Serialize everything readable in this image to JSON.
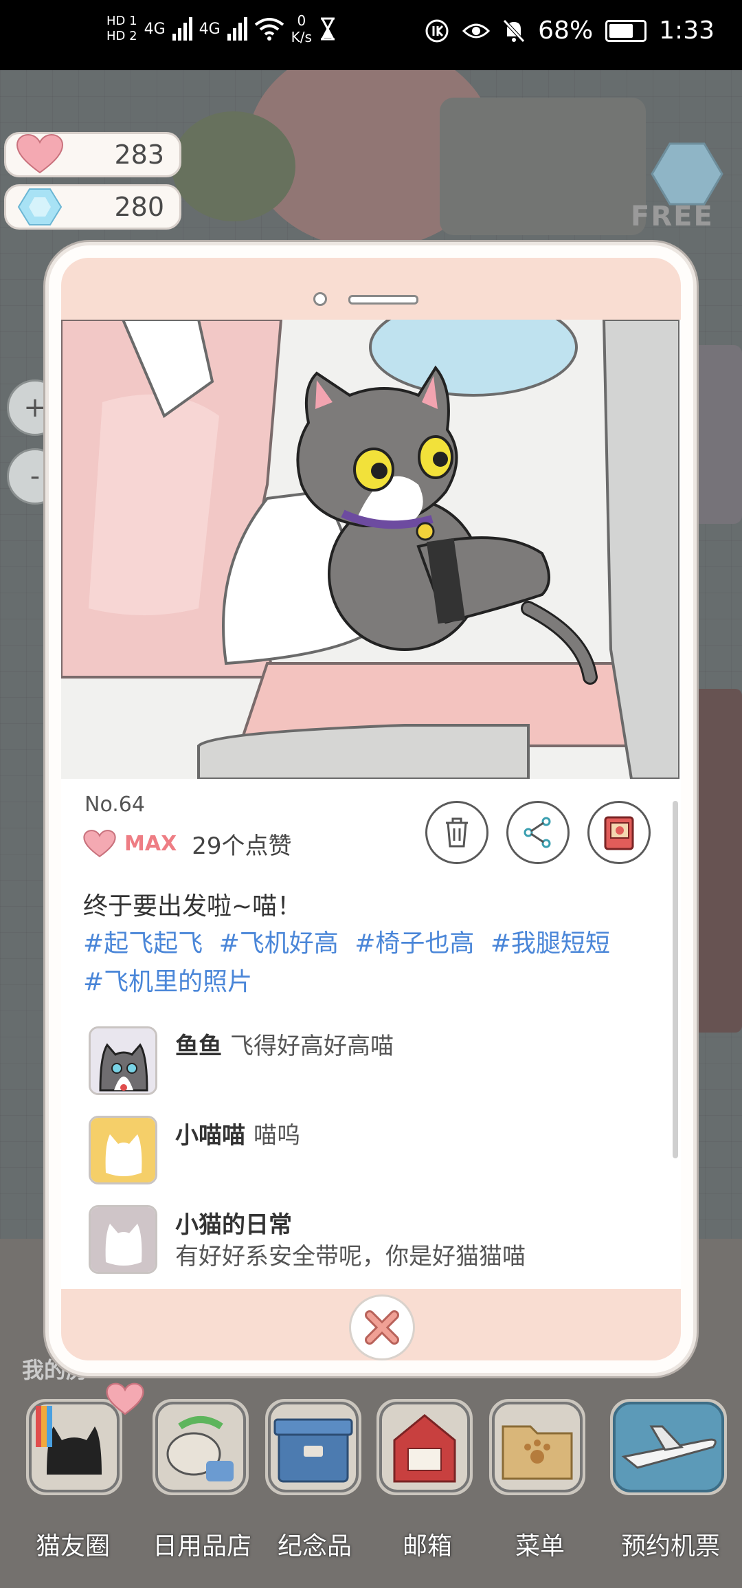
{
  "status_bar": {
    "sim1": "HD 1",
    "sim2": "HD 2",
    "net1": "4G",
    "net2": "4G",
    "speed_value": "0",
    "speed_unit": "K/s",
    "battery": "68%",
    "time": "1:33"
  },
  "game": {
    "hearts": "283",
    "gems": "280",
    "free_label": "FREE",
    "zoom_in": "+",
    "zoom_out": "-",
    "my_room_label": "我的房"
  },
  "post": {
    "number": "No.64",
    "like_level": "MAX",
    "like_count": "29个点赞",
    "caption": "终于要出发啦~喵！",
    "tags": [
      "#起飞起飞",
      "#飞机好高",
      "#椅子也高",
      "#我腿短短",
      "#飞机里的照片"
    ],
    "comments": [
      {
        "name": "鱼鱼",
        "text": "飞得好高好高喵"
      },
      {
        "name": "小喵喵",
        "text": "喵呜"
      },
      {
        "name": "小猫的日常",
        "text": "有好好系安全带呢，你是好猫猫喵"
      }
    ]
  },
  "dock": [
    {
      "label": "猫友圈",
      "icon": "cat-friends-icon"
    },
    {
      "label": "日用品店",
      "icon": "shop-icon"
    },
    {
      "label": "纪念品",
      "icon": "souvenir-box-icon"
    },
    {
      "label": "邮箱",
      "icon": "mailbox-icon"
    },
    {
      "label": "菜单",
      "icon": "menu-folder-icon"
    },
    {
      "label": "预约机票",
      "icon": "airplane-icon"
    }
  ],
  "colors": {
    "accent_pink": "#f9ddd2",
    "tag_blue": "#4a86d8",
    "heart_pink": "#ee7d84"
  }
}
